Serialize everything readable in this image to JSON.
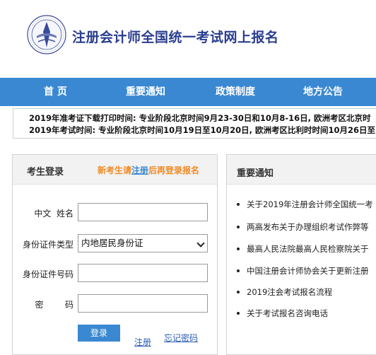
{
  "header": {
    "site_title": "注册会计师全国统一考试网上报名",
    "logo_icon": "cicpa-emblem-icon"
  },
  "nav": {
    "items": [
      {
        "label": "首 页"
      },
      {
        "label": "重要通知"
      },
      {
        "label": "政策制度"
      },
      {
        "label": "地方公告"
      }
    ]
  },
  "notice": {
    "line1_prefix": "2019年准考证下载打印时间: 专业阶段北京时间9月23-30日和10月8-16日, 欧洲考区北京时",
    "line2_prefix": "2019年考试时间: 专业阶段北京时间10月19日至10月20日, 欧洲考区比利时时间10月26日至"
  },
  "login": {
    "title": "考生登录",
    "hint_prefix": "新考生请",
    "hint_link": "注册",
    "hint_suffix": "后再登录报名",
    "name_label": "中文  姓名",
    "id_type_label": "身份证件类型",
    "id_type_value": "内地居民身份证",
    "id_number_label": "身份证件号码",
    "password_label": "密        码",
    "name_value": "",
    "id_number_value": "",
    "password_value": "",
    "login_button": "登录",
    "register_link": "注册",
    "forgot_link": "忘记密码"
  },
  "news": {
    "title": "重要通知",
    "items": [
      {
        "label": "关于2019年注册会计师全国统一考"
      },
      {
        "label": "两高发布关于办理组织考试作弊等"
      },
      {
        "label": "最高人民法院最高人民检察院关于"
      },
      {
        "label": "中国注册会计师协会关于更新注册"
      },
      {
        "label": "2019注会考试报名流程"
      },
      {
        "label": "关于考试报名咨询电话"
      }
    ]
  },
  "colors": {
    "nav_bg": "#3a88d1",
    "title_color": "#2a3e8f",
    "hint_orange": "#f08a24",
    "link_blue": "#2a5db0"
  }
}
